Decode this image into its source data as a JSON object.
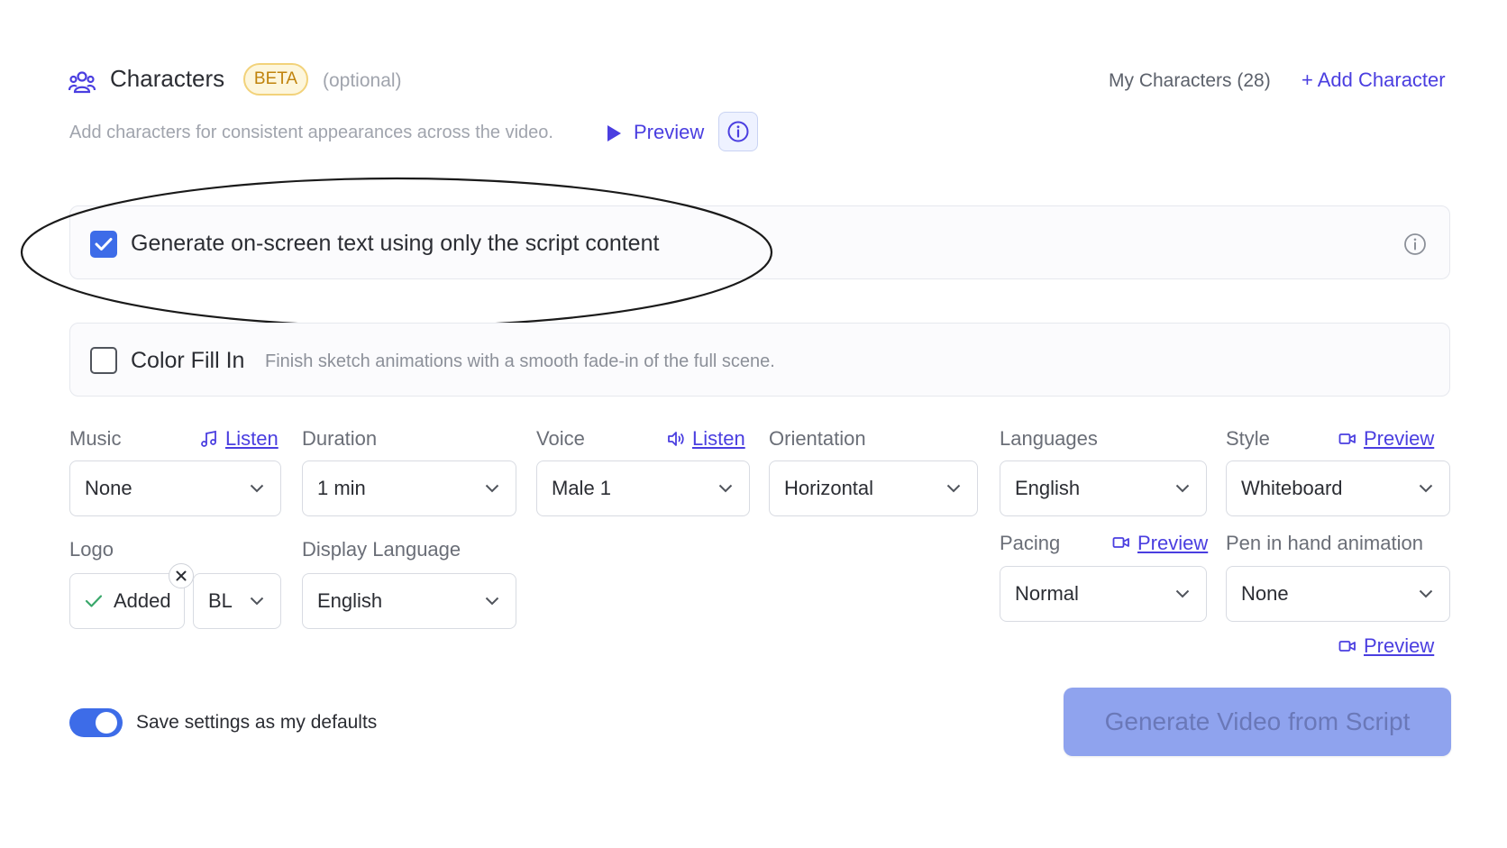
{
  "header": {
    "title": "Characters",
    "badge": "BETA",
    "optional": "(optional)",
    "my_characters": "My Characters (28)",
    "add_character": "+ Add Character",
    "description": "Add characters for consistent appearances across the video.",
    "preview": "Preview",
    "icons": {
      "characters": "users-icon",
      "preview": "play-icon",
      "info": "info-icon"
    }
  },
  "options": {
    "onscreen_text": {
      "label": "Generate on-screen text using only the script content",
      "checked": true
    },
    "color_fill": {
      "label": "Color Fill In",
      "description": "Finish sketch animations with a smooth fade-in of the full scene.",
      "checked": false
    }
  },
  "fields": {
    "music": {
      "label": "Music",
      "link": "Listen",
      "value": "None"
    },
    "duration": {
      "label": "Duration",
      "value": "1 min"
    },
    "voice": {
      "label": "Voice",
      "link": "Listen",
      "value": "Male 1"
    },
    "orientation": {
      "label": "Orientation",
      "value": "Horizontal"
    },
    "languages": {
      "label": "Languages",
      "value": "English"
    },
    "style": {
      "label": "Style",
      "link": "Preview",
      "value": "Whiteboard"
    },
    "logo": {
      "label": "Logo",
      "status": "Added",
      "position": "BL"
    },
    "display_language": {
      "label": "Display Language",
      "value": "English"
    },
    "pacing": {
      "label": "Pacing",
      "link": "Preview",
      "value": "Normal"
    },
    "pen_animation": {
      "label": "Pen in hand animation",
      "value": "None",
      "link": "Preview"
    }
  },
  "footer": {
    "save_defaults": "Save settings as my defaults",
    "save_defaults_on": true,
    "generate": "Generate Video from Script"
  },
  "colors": {
    "accent": "#4a3ee0",
    "checkbox": "#3d6ce8",
    "button": "#8fa3ee",
    "badge": "#c0830c"
  }
}
